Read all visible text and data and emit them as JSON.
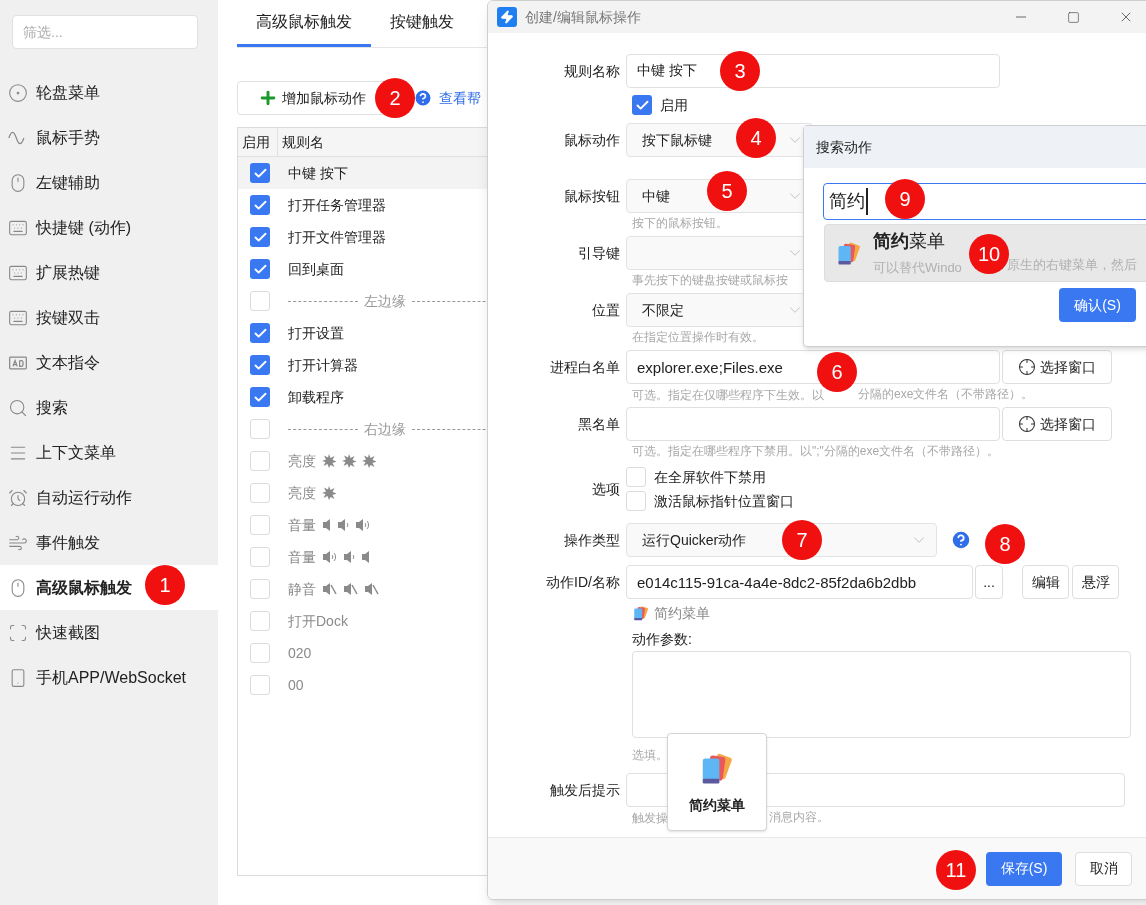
{
  "sidebar": {
    "filter": {
      "placeholder": "筛选..."
    },
    "items": [
      {
        "label": "轮盘菜单",
        "selected": false
      },
      {
        "label": "鼠标手势",
        "selected": false
      },
      {
        "label": "左键辅助",
        "selected": false
      },
      {
        "label": "快捷键 (动作)",
        "selected": false
      },
      {
        "label": "扩展热键",
        "selected": false
      },
      {
        "label": "按键双击",
        "selected": false
      },
      {
        "label": "文本指令",
        "selected": false
      },
      {
        "label": "搜索",
        "selected": false
      },
      {
        "label": "上下文菜单",
        "selected": false
      },
      {
        "label": "自动运行动作",
        "selected": false
      },
      {
        "label": "事件触发",
        "selected": false
      },
      {
        "label": "高级鼠标触发",
        "selected": true
      },
      {
        "label": "快速截图",
        "selected": false
      },
      {
        "label": "手机APP/WebSocket",
        "selected": false
      }
    ]
  },
  "tabs": [
    {
      "label": "高级鼠标触发",
      "selected": true
    },
    {
      "label": "按键触发",
      "selected": false
    }
  ],
  "toolbar": {
    "add_button": "增加鼠标动作",
    "help_link": "查看帮"
  },
  "table": {
    "columns": [
      "启用",
      "规则名"
    ],
    "rows": [
      {
        "kind": "rule",
        "enabled": true,
        "name": "中键 按下",
        "selected": true
      },
      {
        "kind": "rule",
        "enabled": true,
        "name": "打开任务管理器",
        "selected": false
      },
      {
        "kind": "rule",
        "enabled": true,
        "name": "打开文件管理器",
        "selected": false
      },
      {
        "kind": "rule",
        "enabled": true,
        "name": "回到桌面",
        "selected": false
      },
      {
        "kind": "separator",
        "enabled": false,
        "name": "左边缘",
        "selected": false
      },
      {
        "kind": "rule",
        "enabled": true,
        "name": "打开设置",
        "selected": false
      },
      {
        "kind": "rule",
        "enabled": true,
        "name": "打开计算器",
        "selected": false
      },
      {
        "kind": "rule",
        "enabled": true,
        "name": "卸载程序",
        "selected": false
      },
      {
        "kind": "separator",
        "enabled": false,
        "name": "右边缘",
        "selected": false
      },
      {
        "kind": "brightness-up",
        "enabled": false,
        "name": "亮度",
        "selected": false
      },
      {
        "kind": "brightness-down",
        "enabled": false,
        "name": "亮度",
        "selected": false
      },
      {
        "kind": "volume-up",
        "enabled": false,
        "name": "音量",
        "selected": false
      },
      {
        "kind": "volume-down",
        "enabled": false,
        "name": "音量",
        "selected": false
      },
      {
        "kind": "mute",
        "enabled": false,
        "name": "静音",
        "selected": false
      },
      {
        "kind": "rule",
        "enabled": false,
        "name": "打开Dock",
        "selected": false
      },
      {
        "kind": "rule",
        "enabled": false,
        "name": "020",
        "selected": false
      },
      {
        "kind": "rule",
        "enabled": false,
        "name": "00",
        "selected": false
      }
    ]
  },
  "dialog": {
    "title": "创建/编辑鼠标操作",
    "rule_name": {
      "label": "规则名称",
      "value": "中键 按下"
    },
    "enabled": {
      "label": "启用",
      "checked": true
    },
    "mouse_action": {
      "label": "鼠标动作",
      "value": "按下鼠标键"
    },
    "mouse_button": {
      "label": "鼠标按钮",
      "value": "中键",
      "hint": "按下的鼠标按钮。"
    },
    "lead_key": {
      "label": "引导键",
      "hint": "事先按下的键盘按键或鼠标按"
    },
    "position": {
      "label": "位置",
      "value": "不限定",
      "hint": "在指定位置操作时有效。"
    },
    "whitelist": {
      "label": "进程白名单",
      "value": "explorer.exe;Files.exe",
      "hint": [
        "可选。指定在仅哪些程序下生效。以",
        "分隔的exe文件名（不带路径）。"
      ],
      "button": "选择窗口"
    },
    "blacklist": {
      "label": "黑名单",
      "hint": "可选。指定在哪些程序下禁用。以\";\"分隔的exe文件名（不带路径）。",
      "button": "选择窗口"
    },
    "options": {
      "label": "选项",
      "items": [
        {
          "label": "在全屏软件下禁用",
          "checked": false
        },
        {
          "label": "激活鼠标指针位置窗口",
          "checked": false
        }
      ]
    },
    "action_type": {
      "label": "操作类型",
      "value": "运行Quicker动作"
    },
    "action_id": {
      "label": "动作ID/名称",
      "value": "e014c115-91ca-4a4e-8dc2-85f2da6b2dbb",
      "more_button": "...",
      "buttons": [
        "编辑",
        "悬浮"
      ]
    },
    "action_name": "简约菜单",
    "params": {
      "label": "动作参数:",
      "hint": "选填。"
    },
    "notify": {
      "label": "触发后提示",
      "hint": [
        "触发操",
        "消息内容。"
      ]
    },
    "footer": {
      "save": "保存(S)",
      "cancel": "取消"
    }
  },
  "search_popup": {
    "title": "搜索动作",
    "query": "简约",
    "results": [
      {
        "title": "**简约**菜单",
        "description": [
          "可以替代Windo",
          "原生的右键菜单，然后"
        ],
        "selected": true
      }
    ],
    "confirm": "确认(S)"
  },
  "tooltip": {
    "label": "简约菜单"
  },
  "markers": [
    "1",
    "2",
    "3",
    "4",
    "5",
    "6",
    "7",
    "8",
    "9",
    "10",
    "11"
  ]
}
